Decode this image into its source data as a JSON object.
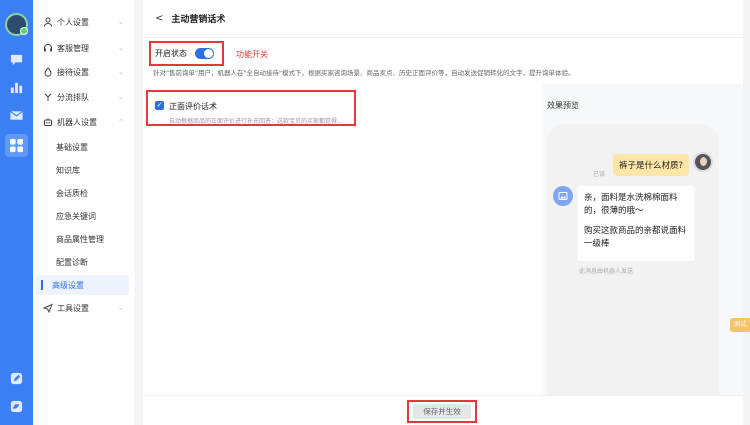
{
  "sidebar": {
    "items": [
      {
        "label": "个人设置",
        "icon": "person-icon"
      },
      {
        "label": "客服管理",
        "icon": "headset-icon"
      },
      {
        "label": "接待设置",
        "icon": "flame-icon"
      },
      {
        "label": "分流排队",
        "icon": "split-icon"
      },
      {
        "label": "机器人设置",
        "icon": "robot-icon"
      },
      {
        "label": "工具设置",
        "icon": "send-icon"
      }
    ],
    "robot_sub": [
      "基础设置",
      "知识库",
      "会话质检",
      "应急关键词",
      "商品属性管理",
      "配置诊断",
      "高级设置"
    ]
  },
  "header": {
    "back": "<",
    "title": "主动营销话术"
  },
  "toggle": {
    "label": "开启状态",
    "on": true,
    "annotation": "功能开关"
  },
  "description": "针对\"售前询单\"用户，机器人在\"全自动接待\"模式下，根据买家咨询场景、商品卖点、历史正面评价等，自动发送促销转化的文字，提升询单体验。",
  "option": {
    "label": "正面评价话术",
    "checked": true,
    "desc": "自动根据商品的正面评价进行补充回答：这款宝贝的买家都觉得..."
  },
  "preview": {
    "title": "效果预览",
    "question": "裤子是什么材质?",
    "read": "已读",
    "answer_1": "亲，面料是水洗棉棉面料的，很薄的哦～",
    "answer_2": "购买这款商品的亲都说面料一级棒",
    "sent_by": "此消息由机器人发送"
  },
  "side_tab": "测试",
  "footer": {
    "save_label": "保存并生效"
  },
  "colors": {
    "rail": "#3b7ff5",
    "accent": "#2f6fe4",
    "highlight": "#e03a3a",
    "bubble": "#fde6a7"
  }
}
